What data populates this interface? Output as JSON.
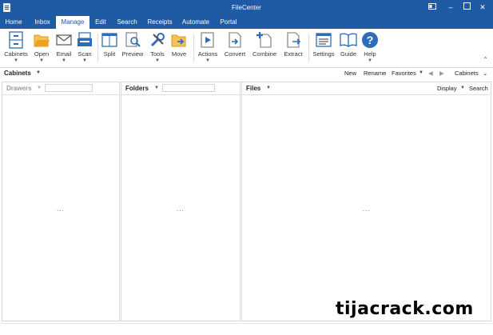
{
  "window": {
    "title": "FileCenter",
    "controls": [
      "minimize",
      "maximize",
      "close"
    ]
  },
  "tabs": [
    {
      "label": "Home"
    },
    {
      "label": "Inbox"
    },
    {
      "label": "Manage",
      "active": true
    },
    {
      "label": "Edit"
    },
    {
      "label": "Search"
    },
    {
      "label": "Receipts"
    },
    {
      "label": "Automate"
    },
    {
      "label": "Portal"
    }
  ],
  "ribbon": {
    "cabinets": "Cabinets",
    "open": "Open",
    "email": "Email",
    "scan": "Scan",
    "split": "Split",
    "preview": "Preview",
    "tools": "Tools",
    "move": "Move",
    "actions": "Actions",
    "convert": "Convert",
    "combine": "Combine",
    "extract": "Extract",
    "settings": "Settings",
    "guide": "Guide",
    "help": "Help"
  },
  "cabinet_bar": {
    "title": "Cabinets",
    "new": "New",
    "rename": "Rename",
    "favorites": "Favorites",
    "current": "Cabinets"
  },
  "panes": {
    "drawers": {
      "title": "Drawers",
      "placeholder": "..."
    },
    "folders": {
      "title": "Folders",
      "placeholder": "..."
    },
    "files": {
      "title": "Files",
      "display": "Display",
      "search": "Search",
      "placeholder": "..."
    }
  },
  "watermark": "tijacrack.com",
  "colors": {
    "accent": "#1f5aa5",
    "icon_blue": "#2e6cb8",
    "folder_orange": "#f0a020"
  }
}
